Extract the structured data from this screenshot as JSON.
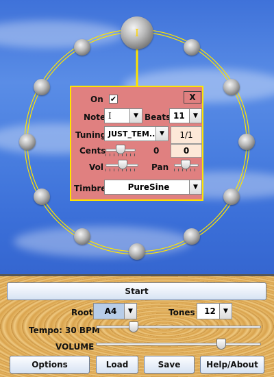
{
  "wheel": {
    "center_note": "I",
    "ring_color": "#ffe400"
  },
  "panel": {
    "on_label": "On",
    "on_checked": true,
    "close_label": "X",
    "note_label": "Note",
    "note_value": "I",
    "beats_label": "Beats",
    "beats_value": "11",
    "tuning_label": "Tuning",
    "tuning_value": "JUST_TEM...",
    "ratio_value": "1/1",
    "cents_label": "Cents",
    "cents_value": "0",
    "vol_label": "Vol",
    "pan_label": "Pan",
    "pan_value": "0",
    "timbre_label": "Timbre",
    "timbre_value": "PureSine",
    "bg_color": "#e08080"
  },
  "controls": {
    "start_label": "Start",
    "root_label": "Root",
    "root_value": "A4",
    "tones_label": "Tones",
    "tones_value": "12",
    "tempo_label": "Tempo: 30 BPM",
    "volume_label": "VOLUME",
    "options_label": "Options",
    "load_label": "Load",
    "save_label": "Save",
    "help_label": "Help/About"
  }
}
